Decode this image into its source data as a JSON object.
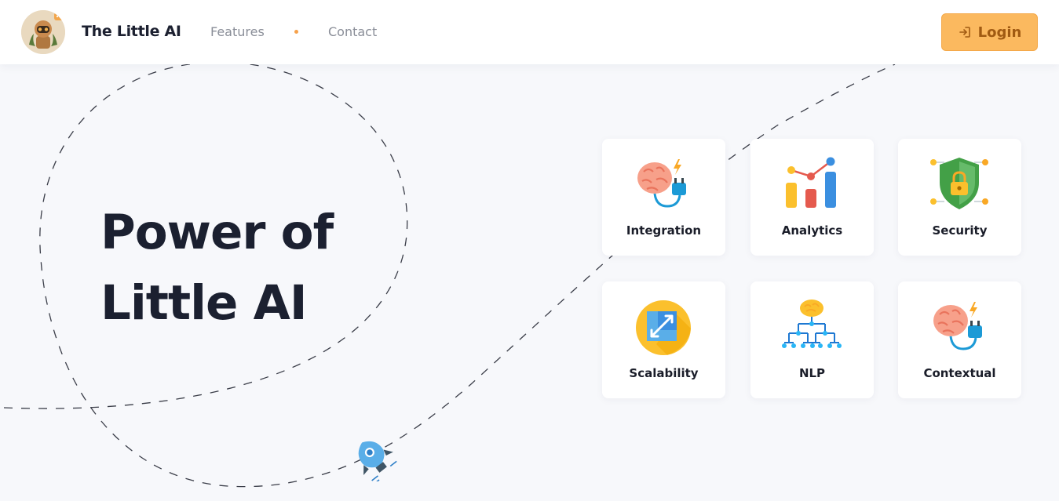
{
  "header": {
    "brand": "The Little AI",
    "nav": [
      {
        "label": "Features"
      },
      {
        "label": "Contact"
      }
    ],
    "login_label": "Login"
  },
  "hero": {
    "title_line1": "Power of",
    "title_line2": "Little AI"
  },
  "features": [
    {
      "label": "Integration",
      "icon": "brain-plug-icon"
    },
    {
      "label": "Analytics",
      "icon": "analytics-chart-icon"
    },
    {
      "label": "Security",
      "icon": "shield-lock-icon"
    },
    {
      "label": "Scalability",
      "icon": "scale-arrows-icon"
    },
    {
      "label": "NLP",
      "icon": "neural-network-icon"
    },
    {
      "label": "Contextual",
      "icon": "brain-plug-icon"
    }
  ],
  "colors": {
    "accent": "#fbb95f",
    "accent_text": "#a05a12",
    "heading": "#1b2030",
    "background": "#f7f8fb"
  }
}
